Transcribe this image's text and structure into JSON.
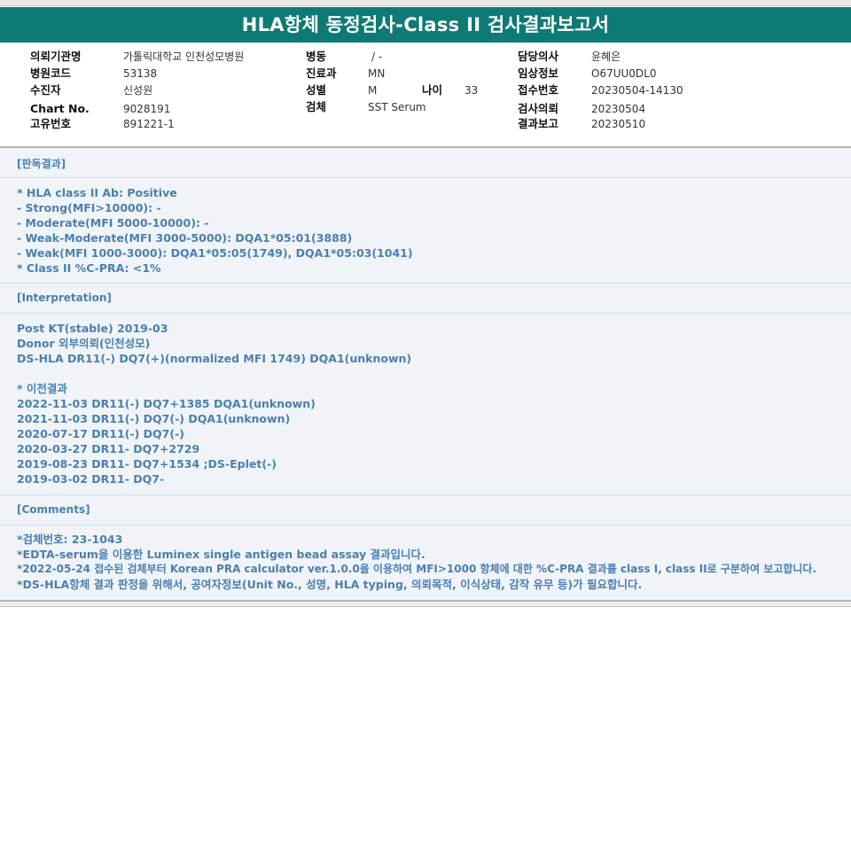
{
  "title": "HLA항체 동정검사-Class II 검사결과보고서",
  "info": {
    "col1": [
      {
        "label": "의뢰기관명",
        "value": "가톨릭대학교 인천성모병원"
      },
      {
        "label": "병원코드",
        "value": "53138"
      },
      {
        "label": "수진자",
        "value": "신성원"
      },
      {
        "label": "Chart No.",
        "value": "9028191"
      },
      {
        "label": "고유번호",
        "value": "891221-1"
      }
    ],
    "col2": [
      {
        "label": "병동",
        "value": "/ -"
      },
      {
        "label": "진료과",
        "value": "MN"
      },
      {
        "label": "성별",
        "value": "M"
      },
      {
        "label": "검체",
        "value": "SST Serum"
      }
    ],
    "age": {
      "label": "나이",
      "value": "33"
    },
    "col3": [
      {
        "label": "담당의사",
        "value": "윤혜은"
      },
      {
        "label": "임상정보",
        "value": "O67UU0DL0"
      },
      {
        "label": "접수번호",
        "value": "20230504-14130"
      },
      {
        "label": "검사의뢰",
        "value": "20230504"
      },
      {
        "label": "결과보고",
        "value": "20230510"
      }
    ]
  },
  "sections": {
    "result": {
      "heading": "[판독결과]",
      "lines": [
        "* HLA class II Ab: Positive",
        "- Strong(MFI>10000): -",
        "- Moderate(MFI 5000-10000): -",
        "- Weak-Moderate(MFI 3000-5000): DQA1*05:01(3888)",
        "- Weak(MFI 1000-3000): DQA1*05:05(1749), DQA1*05:03(1041)",
        "* Class II %C-PRA: <1%"
      ]
    },
    "interpretation": {
      "heading": "[Interpretation]",
      "lines": [
        "Post KT(stable) 2019-03",
        "Donor 외부의뢰(인천성모)",
        "DS-HLA DR11(-) DQ7(+)(normalized MFI 1749) DQA1(unknown)",
        "",
        "* 이전결과",
        "2022-11-03 DR11(-) DQ7+1385 DQA1(unknown)",
        "2021-11-03 DR11(-) DQ7(-) DQA1(unknown)",
        "2020-07-17 DR11(-) DQ7(-)",
        "2020-03-27 DR11- DQ7+2729",
        "2019-08-23 DR11- DQ7+1534 ;DS-Eplet(-)",
        "2019-03-02 DR11- DQ7-"
      ]
    },
    "comments": {
      "heading": "[Comments]",
      "lines": [
        "*검체번호: 23-1043",
        "*EDTA-serum을 이용한 Luminex single antigen bead assay 결과입니다.",
        "*2022-05-24 접수된 검체부터 Korean PRA calculator ver.1.0.0을 이용하여 MFI>1000 항체에 대한 %C-PRA 결과를 class I, class II로 구분하여 보고합니다.",
        "*DS-HLA항체 결과 판정을 위해서, 공여자정보(Unit No., 성명, HLA typing, 의뢰목적, 이식상태, 감작 유무 등)가 필요합니다."
      ]
    }
  },
  "colors": {
    "title_bg": "#0e7a74",
    "report_text": "#4a7fb0",
    "report_bg": "#f0f4f8"
  }
}
